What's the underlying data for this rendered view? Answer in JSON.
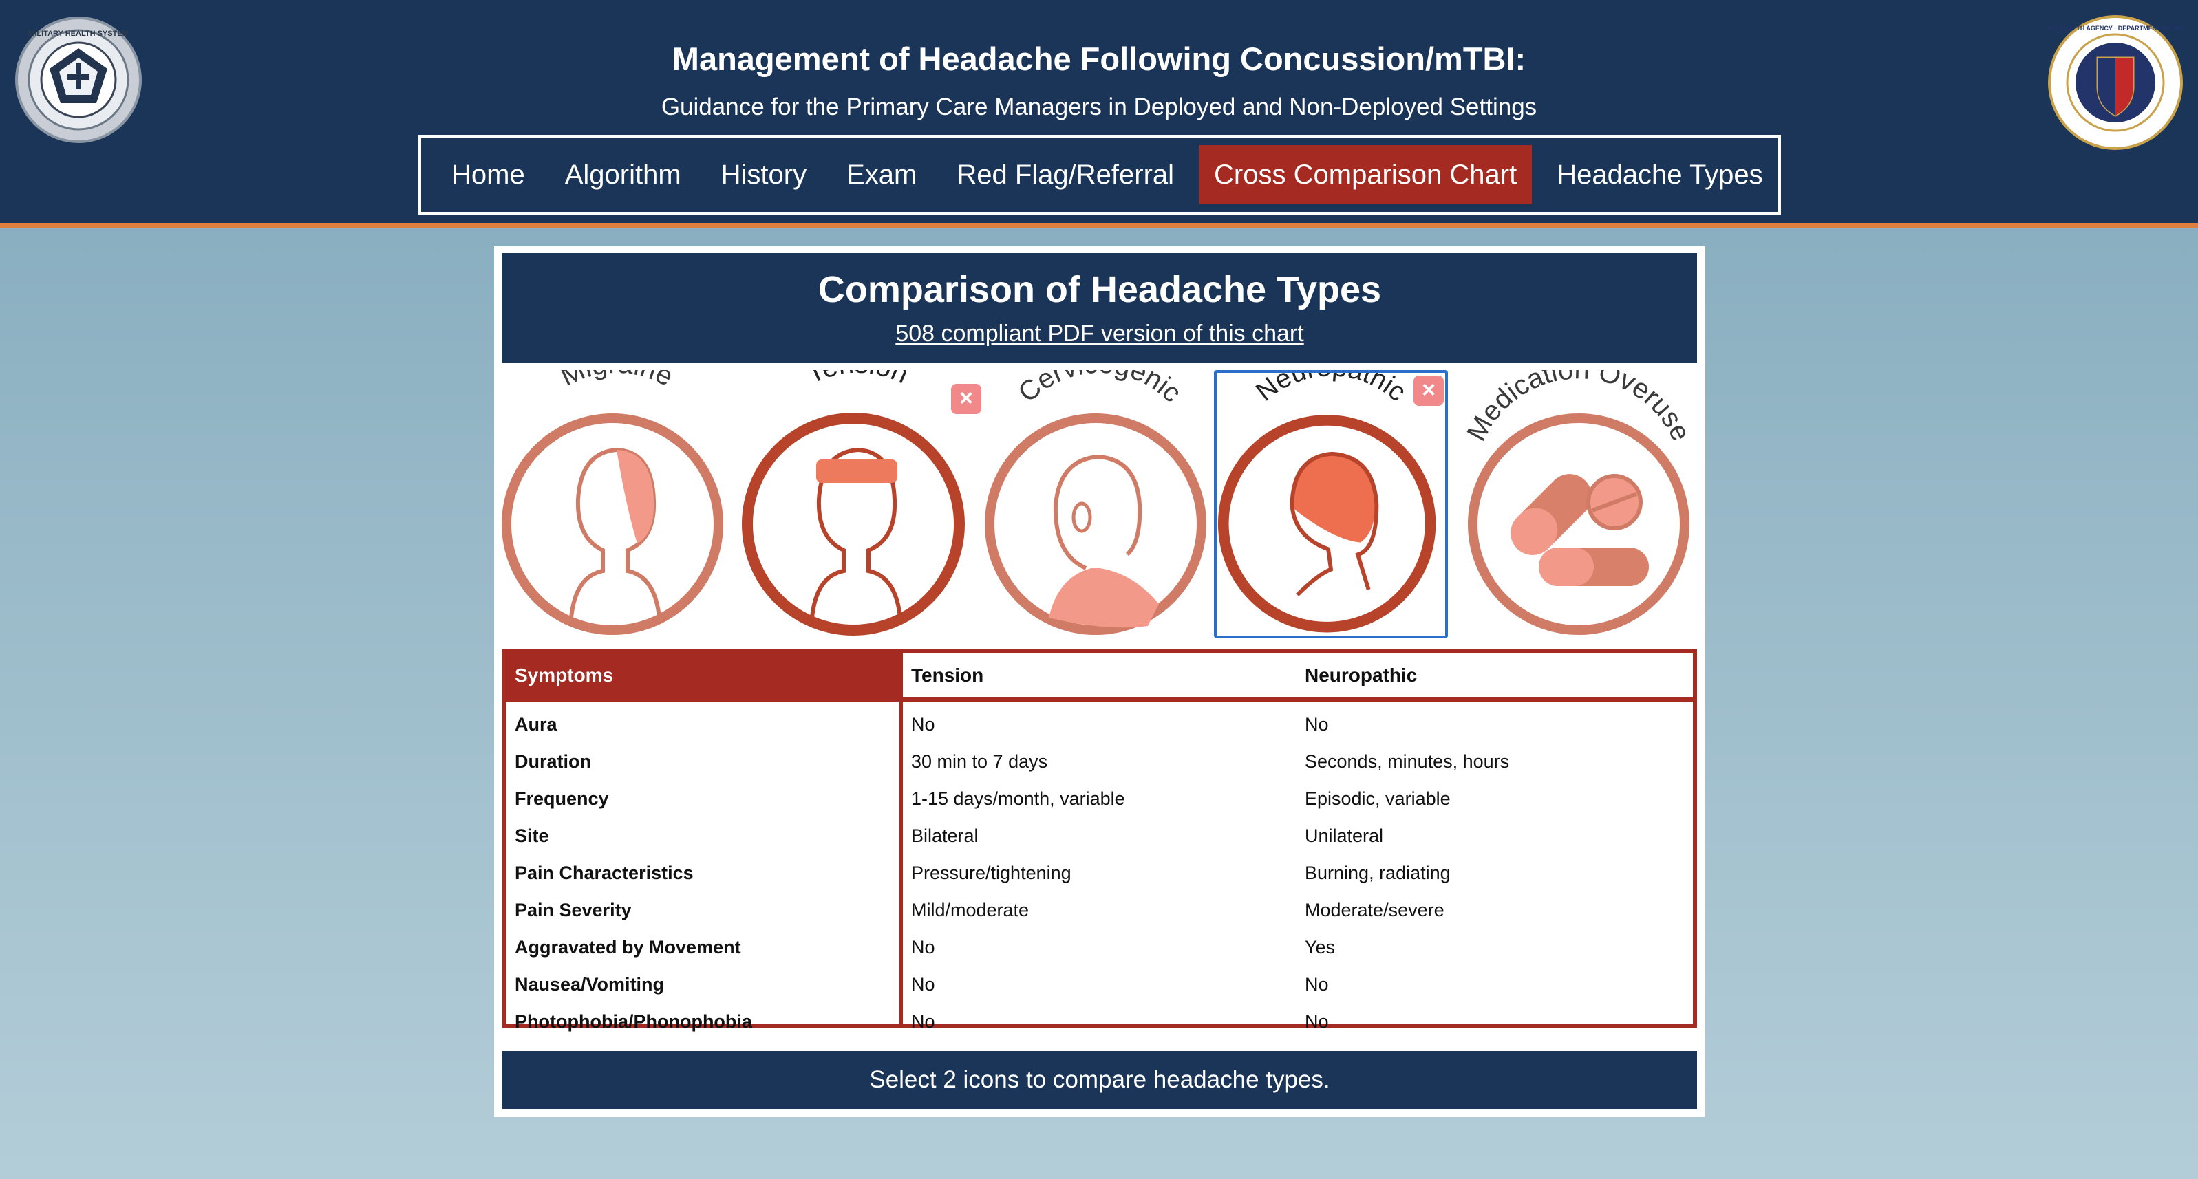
{
  "header": {
    "title": "Management of Headache Following Concussion/mTBI:",
    "subtitle": "Guidance for the Primary Care Managers in Deployed and Non-Deployed Settings",
    "logo_left_icon": "military-health-system-seal",
    "logo_right_icon": "defense-health-agency-seal",
    "logo_left_text": "MILITARY HEALTH SYSTEM",
    "logo_right_text": "DEFENSE HEALTH AGENCY · DEPARTMENT OF DEFENSE"
  },
  "nav": {
    "items": [
      {
        "label": "Home"
      },
      {
        "label": "Algorithm"
      },
      {
        "label": "History"
      },
      {
        "label": "Exam"
      },
      {
        "label": "Red Flag/Referral"
      },
      {
        "label": "Cross Comparison Chart",
        "active": true
      },
      {
        "label": "Headache Types"
      }
    ]
  },
  "panel": {
    "title": "Comparison of Headache Types",
    "pdf_link": "508 compliant PDF version of this chart",
    "footer": "Select 2 icons to compare headache types."
  },
  "icons": [
    {
      "label": "Migraine",
      "icon": "migraine-head-icon",
      "selected": false
    },
    {
      "label": "Tension",
      "icon": "tension-head-icon",
      "selected": true
    },
    {
      "label": "Cervicogenic",
      "icon": "cervicogenic-head-icon",
      "selected": false
    },
    {
      "label": "Neuropathic",
      "icon": "neuropathic-head-icon",
      "selected": true
    },
    {
      "label": "Medication Overuse",
      "icon": "medication-pills-icon",
      "selected": false
    }
  ],
  "close_glyph": "×",
  "table": {
    "headers": [
      "Symptoms",
      "Tension",
      "Neuropathic"
    ],
    "rows": [
      [
        "Aura",
        "No",
        "No"
      ],
      [
        "Duration",
        "30 min to 7 days",
        "Seconds, minutes, hours"
      ],
      [
        "Frequency",
        "1-15 days/month, variable",
        "Episodic, variable"
      ],
      [
        "Site",
        "Bilateral",
        "Unilateral"
      ],
      [
        "Pain Characteristics",
        "Pressure/tightening",
        "Burning, radiating"
      ],
      [
        "Pain Severity",
        "Mild/moderate",
        "Moderate/severe"
      ],
      [
        "Aggravated by Movement",
        "No",
        "Yes"
      ],
      [
        "Nausea/Vomiting",
        "No",
        "No"
      ],
      [
        "Photophobia/Phonophobia",
        "No",
        "No"
      ]
    ]
  },
  "colors": {
    "navy": "#1b3558",
    "red": "#a52a22",
    "orange_rule": "#dd7f3e",
    "icon_light": "#cf7b66",
    "icon_dark": "#b8432b",
    "select_blue": "#2b6fc9"
  }
}
